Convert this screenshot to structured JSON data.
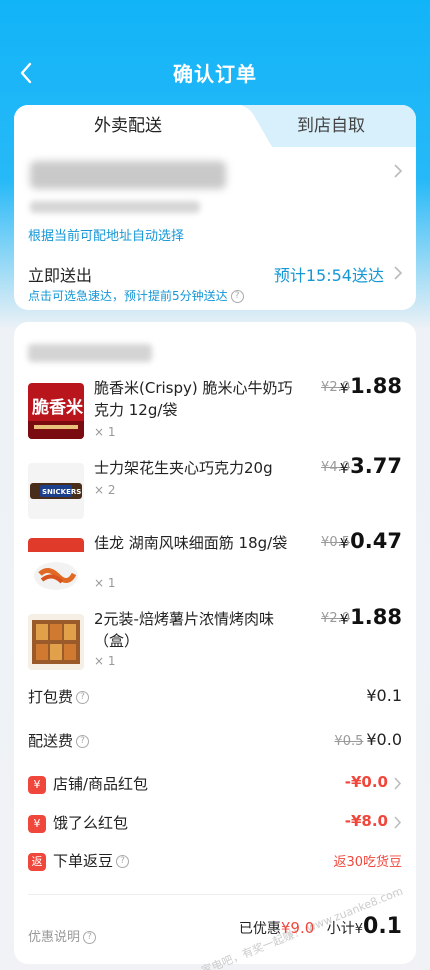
{
  "header": {
    "title": "确认订单"
  },
  "tabs": {
    "delivery": "外卖配送",
    "pickup": "到店自取"
  },
  "address": {
    "note": "根据当前可配地址自动选择"
  },
  "delivery_time": {
    "label": "立即送出",
    "eta": "预计15:54送达",
    "hint": "点击可选急速达，预计提前5分钟送达"
  },
  "items": [
    {
      "name": "脆香米(Crispy) 脆米心牛奶巧克力 12g/袋",
      "qty": "× 1",
      "orig": "¥2.0",
      "price": "1.88",
      "img": "chocolate"
    },
    {
      "name": "士力架花生夹心巧克力20g",
      "qty": "× 2",
      "orig": "¥4.0",
      "price": "3.77",
      "img": "snickers"
    },
    {
      "name": "佳龙 湖南风味细面筋 18g/袋",
      "qty": "× 1",
      "orig": "¥0.5",
      "price": "0.47",
      "img": "snack"
    },
    {
      "name": "2元装-焙烤薯片浓情烤肉味（盒）",
      "qty": "× 1",
      "orig": "¥2.0",
      "price": "1.88",
      "img": "chips"
    }
  ],
  "currency": "¥",
  "fees": {
    "packing_label": "打包费",
    "packing_value": "¥0.1",
    "shipping_label": "配送费",
    "shipping_orig": "¥0.5",
    "shipping_value": "¥0.0"
  },
  "promos": {
    "store_icon": "¥",
    "store_label": "店铺/商品红包",
    "store_value": "-¥0.0",
    "ele_icon": "¥",
    "ele_label": "饿了么红包",
    "ele_value": "-¥8.0",
    "bean_icon": "返",
    "bean_label": "下单返豆",
    "bean_value": "返30吃货豆"
  },
  "footer": {
    "discount_note": "优惠说明",
    "saved_label": "已优惠",
    "saved_value": "¥9.0",
    "subtotal_label": "小计",
    "subtotal_value": "0.1"
  },
  "watermark": "家电吧，有奖一起赚！ www.zuanke8.com",
  "colors": {
    "brand_blue": "#12b4f8",
    "link_blue": "#1597d6",
    "red": "#f0473d"
  }
}
